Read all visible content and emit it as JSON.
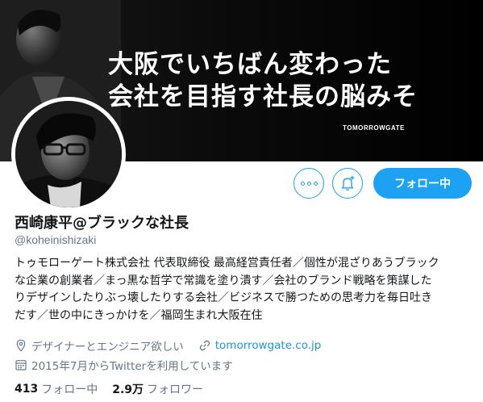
{
  "banner": {
    "line1": "大阪でいちばん変わった",
    "line2": "会社を目指す社長の脳みそ",
    "brand": "TOMORROWGATE"
  },
  "actions": {
    "more_icon": "more-horizontal-icon",
    "notify_icon": "bell-plus-icon",
    "follow_label": "フォロー中",
    "accent_color": "#1da1f2"
  },
  "profile": {
    "name": "西崎康平@ブラックな社長",
    "handle": "@koheinishizaki",
    "bio_lines": [
      "トゥモローゲート株式会社 代表取締役 最高経営責任者／個性が混ざりあうブラック",
      "な企業の創業者／まっ黒な哲学で常識を塗り潰す／会社のブランド戦略を策謀した",
      "りデザインしたりぶっ壊したりする会社／ビジネスで勝つための思考力を毎日吐き",
      "だす／世の中にきっかけを／福岡生まれ大阪在住"
    ],
    "location": "デザイナーとエンジニア欲しい",
    "website": "tomorrowgate.co.jp",
    "joined": "2015年7月からTwitterを利用しています"
  },
  "stats": {
    "following_count": "413",
    "following_label": "フォロー中",
    "followers_count": "2.9万",
    "followers_label": "フォロワー"
  }
}
